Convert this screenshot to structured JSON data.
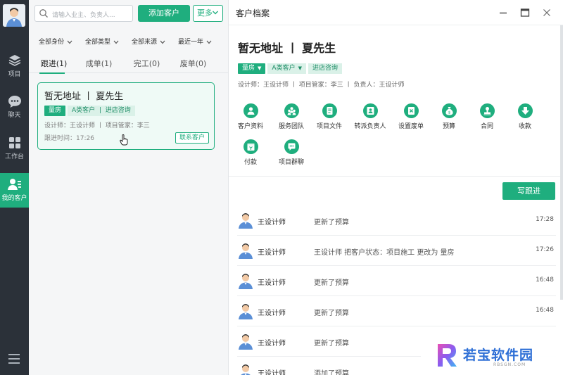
{
  "colors": {
    "accent": "#1fae7e",
    "rail_bg": "#2b3139"
  },
  "rail": {
    "items": [
      {
        "label": "项目",
        "icon": "layers-icon"
      },
      {
        "label": "聊天",
        "icon": "chat-bubble-icon"
      },
      {
        "label": "工作台",
        "icon": "grid-icon"
      },
      {
        "label": "我的客户",
        "icon": "customers-icon",
        "active": true
      }
    ],
    "menu_icon": "hamburger-menu-icon"
  },
  "list": {
    "search_placeholder": "请输入业主、负责人...",
    "add_button": "添加客户",
    "more_button": "更多",
    "filters": [
      "全部身份",
      "全部类型",
      "全部来源",
      "最近一年"
    ],
    "tabs": [
      "跟进(1)",
      "成单(1)",
      "完工(0)",
      "废单(0)"
    ],
    "active_tab": "跟进(1)",
    "card": {
      "title": "暂无地址 丨 夏先生",
      "tag_stage": "量房",
      "tag_class": "A类客户",
      "tag_separator": "|",
      "tag_source": "进店咨询",
      "meta": "设计师：王设计师  丨  项目管家：李三",
      "time": "跟进时间：17:26",
      "contact_button": "联系客户"
    }
  },
  "detail": {
    "window_title": "客户档案",
    "name": "暂无地址 丨 夏先生",
    "tags": {
      "stage": "量房",
      "class": "A类客户",
      "source": "进店咨询",
      "dropdown_marker": "▼"
    },
    "staff": "设计师：王设计师  丨  项目管家：李三  丨  负责人：王设计师",
    "functions": [
      {
        "label": "客户资料",
        "icon": "profile-icon"
      },
      {
        "label": "服务团队",
        "icon": "team-icon"
      },
      {
        "label": "项目文件",
        "icon": "file-icon"
      },
      {
        "label": "转派负责人",
        "icon": "transfer-icon"
      },
      {
        "label": "设置废单",
        "icon": "void-order-icon"
      },
      {
        "label": "预算",
        "icon": "money-bag-icon"
      },
      {
        "label": "合同",
        "icon": "contract-stamp-icon"
      },
      {
        "label": "收款",
        "icon": "receive-payment-icon"
      },
      {
        "label": "付款",
        "icon": "payment-icon"
      },
      {
        "label": "项目群聊",
        "icon": "group-chat-icon"
      }
    ],
    "write_button": "写跟进",
    "feed": [
      {
        "name": "王设计师",
        "text": "更新了预算",
        "time": "17:28"
      },
      {
        "name": "王设计师",
        "text": "王设计师 把客户状态：项目施工 更改为 量房",
        "time": "17:26"
      },
      {
        "name": "王设计师",
        "text": "更新了预算",
        "time": "16:48"
      },
      {
        "name": "王设计师",
        "text": "更新了预算",
        "time": "16:48"
      },
      {
        "name": "王设计师",
        "text": "更新了预算",
        "time": ""
      },
      {
        "name": "王设计师",
        "text": "添加了预算",
        "time": ""
      }
    ]
  },
  "watermark": {
    "text": "若宝软件园",
    "sub": "RBSGN.COM"
  }
}
